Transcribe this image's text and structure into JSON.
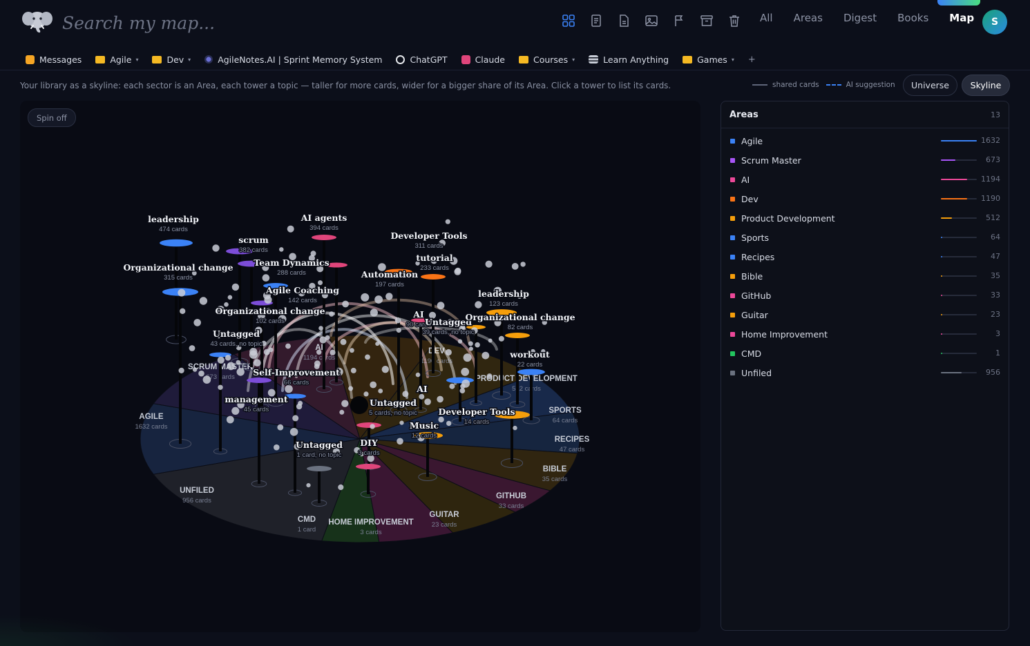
{
  "search": {
    "placeholder": "Search my map..."
  },
  "nav": {
    "items": [
      "All",
      "Areas",
      "Digest",
      "Books",
      "Map"
    ],
    "active": "Map"
  },
  "user": {
    "initial": "S"
  },
  "bookmarks": [
    {
      "label": "Messages",
      "icon": "messages-app-icon",
      "color": "#f5a524",
      "caret": false
    },
    {
      "label": "Agile",
      "icon": "folder-icon",
      "color": "#f5b923",
      "caret": true
    },
    {
      "label": "Dev",
      "icon": "folder-icon",
      "color": "#f5b923",
      "caret": true
    },
    {
      "label": "AgileNotes.AI | Sprint Memory System",
      "icon": "agilenotes-icon",
      "color": "#6b6fd6",
      "caret": false
    },
    {
      "label": "ChatGPT",
      "icon": "chatgpt-icon",
      "color": "#e5e7eb",
      "caret": false
    },
    {
      "label": "Claude",
      "icon": "claude-icon",
      "color": "#e0457b",
      "caret": false
    },
    {
      "label": "Courses",
      "icon": "folder-icon",
      "color": "#f5b923",
      "caret": true
    },
    {
      "label": "Learn Anything",
      "icon": "stack-icon",
      "color": "#c7ccd6",
      "caret": false
    },
    {
      "label": "Games",
      "icon": "folder-icon",
      "color": "#f5b923",
      "caret": true
    }
  ],
  "description": "Your library as a skyline: each sector is an Area, each tower a topic — taller for more cards, wider for a bigger share of its Area. Click a tower to list its cards.",
  "legend": {
    "shared": "shared cards",
    "ai": "AI suggestion"
  },
  "view_toggle": {
    "universe": "Universe",
    "skyline": "Skyline",
    "active": "Skyline"
  },
  "spin_label": "Spin off",
  "areas_panel": {
    "title": "Areas",
    "count": "13",
    "items": [
      {
        "name": "Agile",
        "count": "1632",
        "color": "#3b82f6"
      },
      {
        "name": "Scrum Master",
        "count": "673",
        "color": "#a855f7"
      },
      {
        "name": "AI",
        "count": "1194",
        "color": "#ec4899"
      },
      {
        "name": "Dev",
        "count": "1190",
        "color": "#f97316"
      },
      {
        "name": "Product Development",
        "count": "512",
        "color": "#f59e0b"
      },
      {
        "name": "Sports",
        "count": "64",
        "color": "#3b82f6"
      },
      {
        "name": "Recipes",
        "count": "47",
        "color": "#3b82f6"
      },
      {
        "name": "Bible",
        "count": "35",
        "color": "#f59e0b"
      },
      {
        "name": "GitHub",
        "count": "33",
        "color": "#ec4899"
      },
      {
        "name": "Guitar",
        "count": "23",
        "color": "#f59e0b"
      },
      {
        "name": "Home Improvement",
        "count": "3",
        "color": "#ec4899"
      },
      {
        "name": "CMD",
        "count": "1",
        "color": "#22c55e"
      },
      {
        "name": "Unfiled",
        "count": "956",
        "color": "#6b7280"
      }
    ]
  },
  "skyline": {
    "sectors": [
      {
        "name": "AGILE",
        "sub": "1632 cards",
        "color": "#17243f"
      },
      {
        "name": "SCRUM MASTER",
        "sub": "673 cards",
        "color": "#1f1b3a"
      },
      {
        "name": "AI",
        "sub": "1194 cards",
        "color": "#331a2c"
      },
      {
        "name": "DEV",
        "sub": "1190 cards",
        "color": "#33240f"
      },
      {
        "name": "PRODUCT DEVELOPMENT",
        "sub": "512 cards",
        "color": "#302610"
      },
      {
        "name": "SPORTS",
        "sub": "64 cards",
        "color": "#18294a"
      },
      {
        "name": "RECIPES",
        "sub": "47 cards",
        "color": "#16253f"
      },
      {
        "name": "BIBLE",
        "sub": "35 cards",
        "color": "#302510"
      },
      {
        "name": "GITHUB",
        "sub": "33 cards",
        "color": "#3a1730"
      },
      {
        "name": "GUITAR",
        "sub": "23 cards",
        "color": "#2e250e"
      },
      {
        "name": "HOME IMPROVEMENT",
        "sub": "3 cards",
        "color": "#3a1632"
      },
      {
        "name": "CMD",
        "sub": "1 card",
        "color": "#17321a"
      },
      {
        "name": "UNFILED",
        "sub": "956 cards",
        "color": "#1f2129"
      }
    ],
    "towers": [
      {
        "name": "leadership",
        "sub": "474 cards",
        "color": "#3b82f6"
      },
      {
        "name": "scrum",
        "sub": "382 cards",
        "color": "#7c4dd8"
      },
      {
        "name": "AI agents",
        "sub": "394 cards",
        "color": "#e0457b"
      },
      {
        "name": "Developer Tools",
        "sub": "311 cards",
        "color": "#f97316"
      },
      {
        "name": "Organizational change",
        "sub": "315 cards",
        "color": "#3b82f6"
      },
      {
        "name": "Team Dynamics",
        "sub": "288 cards",
        "color": "#7c4dd8"
      },
      {
        "name": "tutorial",
        "sub": "233 cards",
        "color": "#f97316"
      },
      {
        "name": "Automation",
        "sub": "197 cards",
        "color": "#e0457b"
      },
      {
        "name": "Agile Coaching",
        "sub": "142 cards",
        "color": "#3b82f6"
      },
      {
        "name": "leadership",
        "sub": "123 cards",
        "color": "#f59e0b"
      },
      {
        "name": "Organizational change",
        "sub": "102 cards",
        "color": "#7c4dd8"
      },
      {
        "name": "AI",
        "sub": "90 cards",
        "color": "#e0457b"
      },
      {
        "name": "Untagged",
        "sub": "39 cards, no topic",
        "color": "#f59e0b"
      },
      {
        "name": "Organizational change",
        "sub": "82 cards",
        "color": "#f59e0b"
      },
      {
        "name": "Untagged",
        "sub": "43 cards, no topic",
        "color": "#3b82f6"
      },
      {
        "name": "workout",
        "sub": "22 cards",
        "color": "#3b82f6"
      },
      {
        "name": "Self-Improvement",
        "sub": "66 cards",
        "color": "#7c4dd8"
      },
      {
        "name": "management",
        "sub": "45 cards",
        "color": "#3b82f6"
      },
      {
        "name": "AI",
        "sub": "",
        "color": "#3b82f6"
      },
      {
        "name": "Untagged",
        "sub": "5 cards, no topic",
        "color": "#e0457b"
      },
      {
        "name": "Developer Tools",
        "sub": "14 cards",
        "color": "#f59e0b"
      },
      {
        "name": "Music",
        "sub": "12 cards",
        "color": "#f59e0b"
      },
      {
        "name": "DIY",
        "sub": "3 cards",
        "color": "#e0457b"
      },
      {
        "name": "Untagged",
        "sub": "1 card, no topic",
        "color": "#6b7280"
      }
    ]
  }
}
